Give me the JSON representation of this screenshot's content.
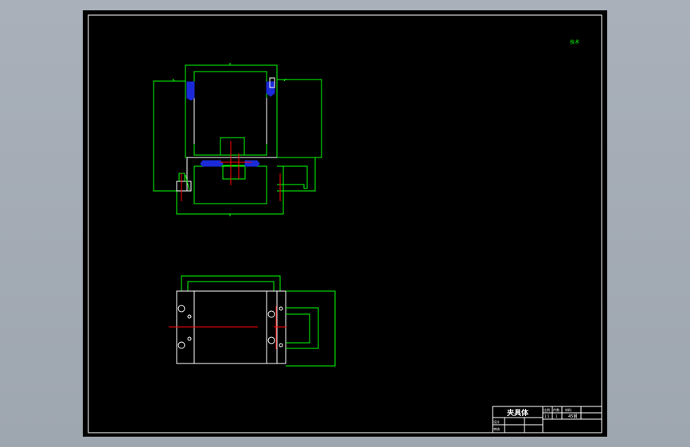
{
  "colors": {
    "background": "#a4abb5",
    "sheet": "#000000",
    "frame": "#ffffff",
    "outline": "#00ff00",
    "centerline": "#ff0000",
    "hatch": "#1a2ad8",
    "edge": "#ffffff"
  },
  "corner_note": "技术",
  "title_block": {
    "part_name": "夹具体",
    "col_scale": "比例",
    "col_qty": "件数",
    "col_mat": "材料",
    "scale_value": "1:1",
    "qty_value": "1",
    "material_value": "45钢",
    "row_design": "设计",
    "row_check": "审核"
  }
}
